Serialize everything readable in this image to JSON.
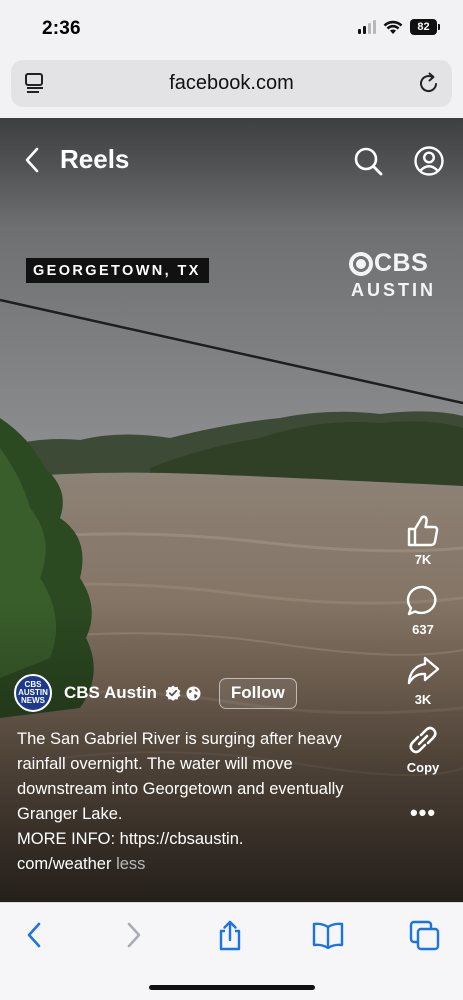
{
  "status_bar": {
    "time": "2:36",
    "battery": "82"
  },
  "browser": {
    "url": "facebook.com"
  },
  "reels": {
    "title": "Reels",
    "overlay": {
      "location": "GEORGETOWN, TX",
      "logo_mark": "CBS",
      "logo_station": "AUSTIN"
    },
    "actions": [
      {
        "icon": "like-icon",
        "count": "7K"
      },
      {
        "icon": "comment-icon",
        "count": "637"
      },
      {
        "icon": "share-icon",
        "count": "3K"
      },
      {
        "icon": "copy-link-icon",
        "count": "Copy"
      }
    ],
    "more": "•••",
    "author": {
      "avatar_text": "CBS AUSTIN NEWS",
      "name": "CBS Austin",
      "follow_label": "Follow"
    },
    "caption": {
      "text": "The San Gabriel River is surging after heavy rainfall overnight. The water will move downstream into Georgetown and eventually Granger Lake.\nMORE INFO: https://cbsaustin.\ncom/weather",
      "less": "less"
    }
  },
  "colors": {
    "accent": "#1a73e8",
    "video_sky": "#8a8c8d",
    "water": "#8b7a68"
  }
}
